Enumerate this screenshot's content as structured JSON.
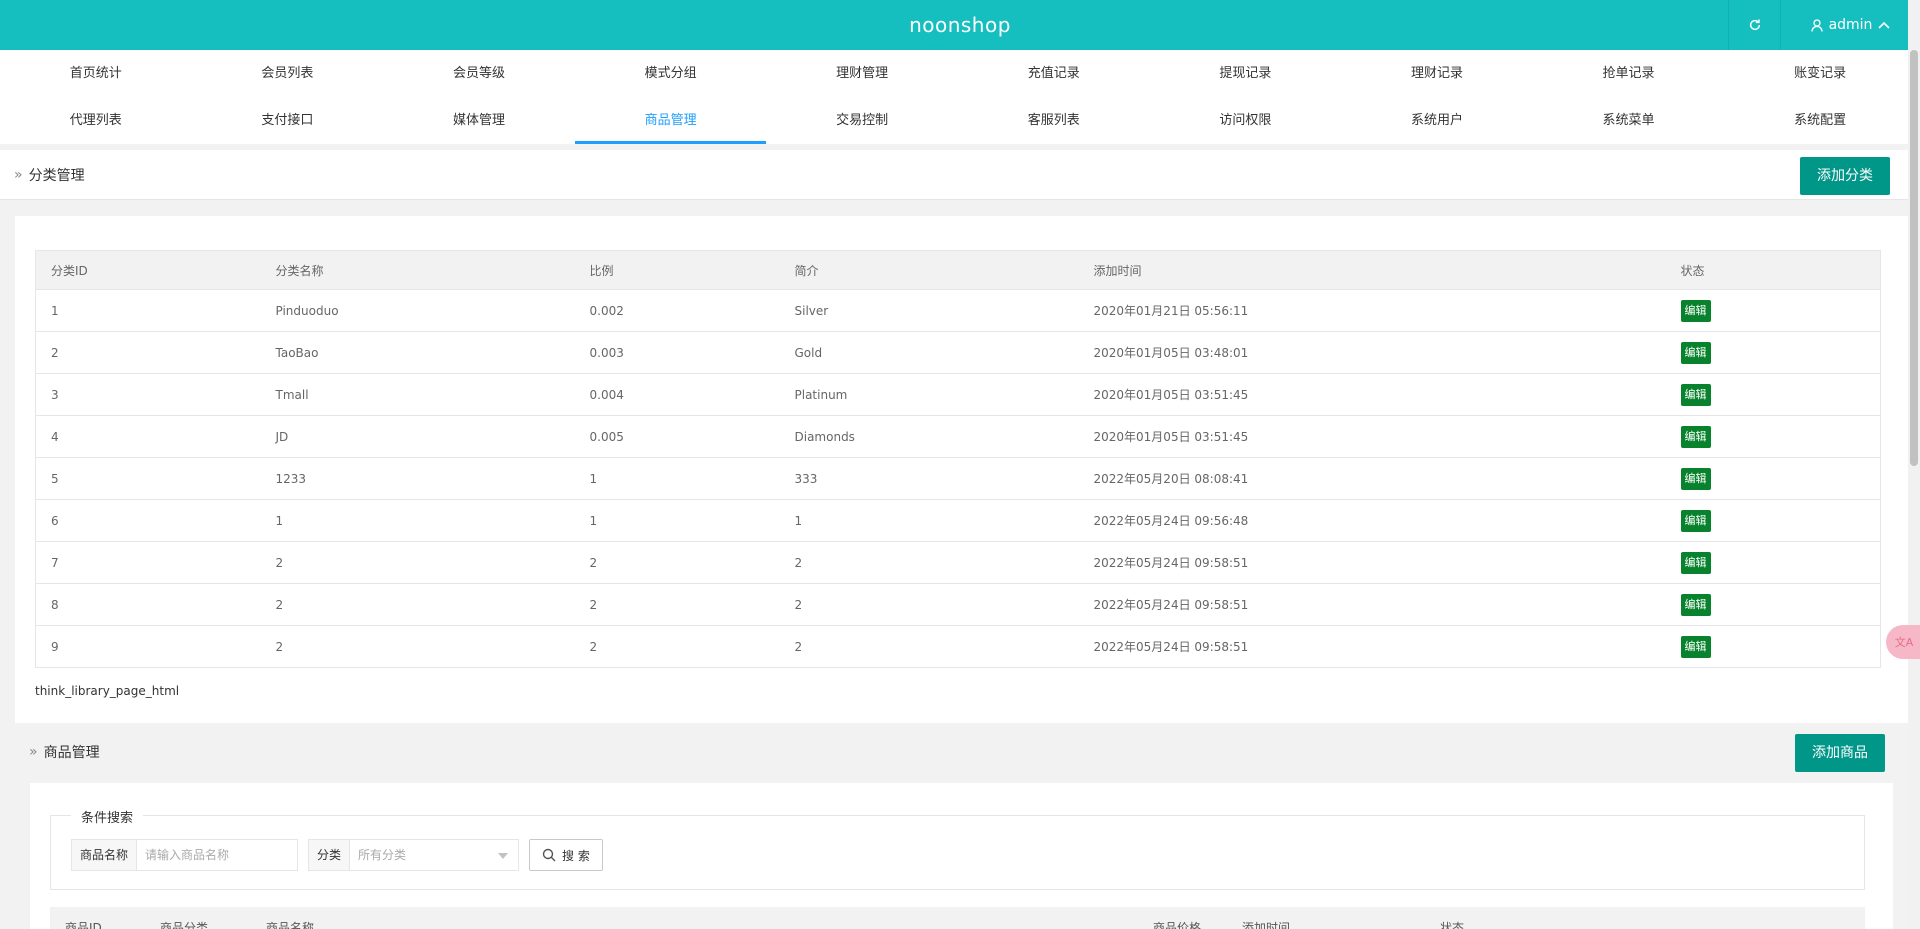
{
  "app": {
    "title": "noonshop",
    "user": "admin",
    "accent": "#16bfbf",
    "primary_button_color": "#009688",
    "active_nav_color": "#1e9fff",
    "edit_tag_color": "#08822d"
  },
  "nav": {
    "row1": [
      "首页统计",
      "会员列表",
      "会员等级",
      "模式分组",
      "理财管理",
      "充值记录",
      "提现记录",
      "理财记录",
      "抢单记录",
      "账变记录"
    ],
    "row2": [
      "代理列表",
      "支付接口",
      "媒体管理",
      "商品管理",
      "交易控制",
      "客服列表",
      "访问权限",
      "系统用户",
      "系统菜单",
      "系统配置"
    ],
    "active": "商品管理"
  },
  "category": {
    "title": "分类管理",
    "add_button": "添加分类",
    "columns": [
      "分类ID",
      "分类名称",
      "比例",
      "简介",
      "添加时间",
      "状态"
    ],
    "rows": [
      [
        "1",
        "Pinduoduo",
        "0.002",
        "Silver",
        "2020年01月21日 05:56:11",
        "编辑"
      ],
      [
        "2",
        "TaoBao",
        "0.003",
        "Gold",
        "2020年01月05日 03:48:01",
        "编辑"
      ],
      [
        "3",
        "Tmall",
        "0.004",
        "Platinum",
        "2020年01月05日 03:51:45",
        "编辑"
      ],
      [
        "4",
        "JD",
        "0.005",
        "Diamonds",
        "2020年01月05日 03:51:45",
        "编辑"
      ],
      [
        "5",
        "1233",
        "1",
        "333",
        "2022年05月20日 08:08:41",
        "编辑"
      ],
      [
        "6",
        "1",
        "1",
        "1",
        "2022年05月24日 09:56:48",
        "编辑"
      ],
      [
        "7",
        "2",
        "2",
        "2",
        "2022年05月24日 09:58:51",
        "编辑"
      ],
      [
        "8",
        "2",
        "2",
        "2",
        "2022年05月24日 09:58:51",
        "编辑"
      ],
      [
        "9",
        "2",
        "2",
        "2",
        "2022年05月24日 09:58:51",
        "编辑"
      ]
    ],
    "pager": "think_library_page_html"
  },
  "goods": {
    "title": "商品管理",
    "add_button": "添加商品",
    "search": {
      "legend": "条件搜索",
      "name_label": "商品名称",
      "name_placeholder": "请输入商品名称",
      "category_label": "分类",
      "category_value": "所有分类",
      "search_button": "搜 索"
    },
    "columns": [
      "商品ID",
      "商品分类",
      "商品名称",
      "商品价格",
      "添加时间",
      "状态"
    ]
  },
  "icons": {
    "refresh": "refresh-icon",
    "user": "user-icon",
    "collapse": "chevron-up-icon",
    "crumb": "double-chevron-right-icon",
    "search": "search-icon",
    "dropdown": "caret-down-icon",
    "translate": "translate-icon"
  }
}
